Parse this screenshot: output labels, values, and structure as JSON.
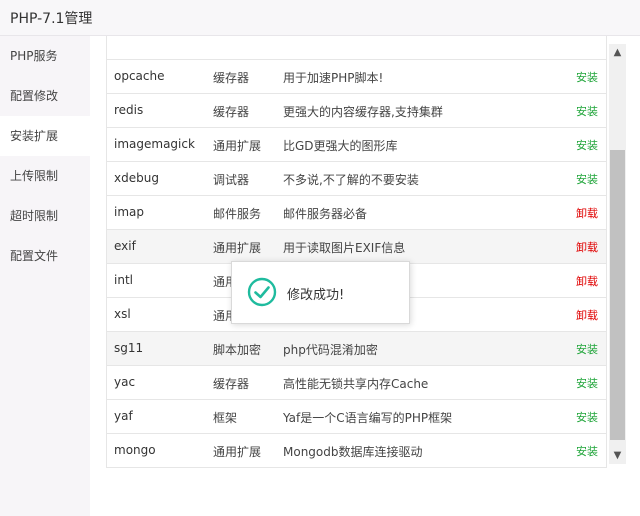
{
  "window": {
    "title": "PHP-7.1管理"
  },
  "sidebar": {
    "items": [
      {
        "label": "PHP服务",
        "active": false
      },
      {
        "label": "配置修改",
        "active": false
      },
      {
        "label": "安装扩展",
        "active": true
      },
      {
        "label": "上传限制",
        "active": false
      },
      {
        "label": "超时限制",
        "active": false
      },
      {
        "label": "配置文件",
        "active": false
      }
    ]
  },
  "extensions": {
    "rows": [
      {
        "name": "opcache",
        "type": "缓存器",
        "desc": "用于加速PHP脚本!",
        "action": "安装",
        "action_kind": "install"
      },
      {
        "name": "redis",
        "type": "缓存器",
        "desc": "更强大的内容缓存器,支持集群",
        "action": "安装",
        "action_kind": "install"
      },
      {
        "name": "imagemagick",
        "type": "通用扩展",
        "desc": "比GD更强大的图形库",
        "action": "安装",
        "action_kind": "install"
      },
      {
        "name": "xdebug",
        "type": "调试器",
        "desc": "不多说,不了解的不要安装",
        "action": "安装",
        "action_kind": "install"
      },
      {
        "name": "imap",
        "type": "邮件服务",
        "desc": "邮件服务器必备",
        "action": "卸载",
        "action_kind": "uninstall"
      },
      {
        "name": "exif",
        "type": "通用扩展",
        "desc": "用于读取图片EXIF信息",
        "action": "卸载",
        "action_kind": "uninstall"
      },
      {
        "name": "intl",
        "type": "通用",
        "desc": "",
        "action": "卸载",
        "action_kind": "uninstall"
      },
      {
        "name": "xsl",
        "type": "通用",
        "desc": "",
        "action": "卸载",
        "action_kind": "uninstall"
      },
      {
        "name": "sg11",
        "type": "脚本加密",
        "desc": "php代码混淆加密",
        "action": "安装",
        "action_kind": "install"
      },
      {
        "name": "yac",
        "type": "缓存器",
        "desc": "高性能无锁共享内存Cache",
        "action": "安装",
        "action_kind": "install"
      },
      {
        "name": "yaf",
        "type": "框架",
        "desc": "Yaf是一个C语言编写的PHP框架",
        "action": "安装",
        "action_kind": "install"
      },
      {
        "name": "mongo",
        "type": "通用扩展",
        "desc": "Mongodb数据库连接驱动",
        "action": "安装",
        "action_kind": "install"
      }
    ]
  },
  "toast": {
    "message": "修改成功!",
    "icon": "check-circle-icon"
  },
  "colors": {
    "install": "#20a53a",
    "uninstall": "#e00000",
    "toast_check": "#1fbb9e"
  }
}
